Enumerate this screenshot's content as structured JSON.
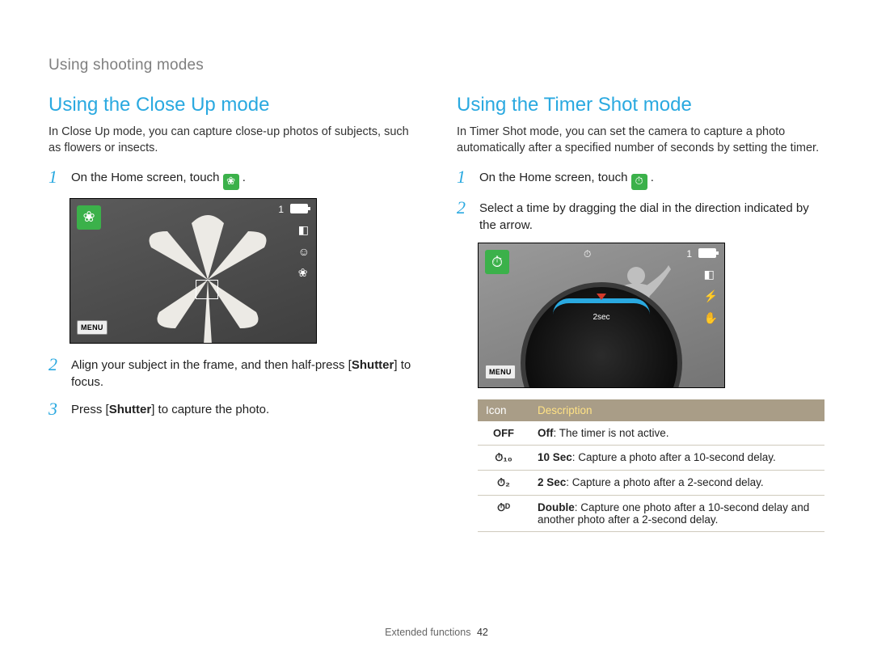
{
  "breadcrumb": "Using shooting modes",
  "footer": {
    "section": "Extended functions",
    "page": "42"
  },
  "left": {
    "heading": "Using the Close Up mode",
    "intro": "In Close Up mode, you can capture close-up photos of subjects, such as flowers or insects.",
    "steps": {
      "s1_pre": "On the Home screen, touch ",
      "s1_post": ".",
      "s2_a": "Align your subject in the frame, and then half-press [",
      "s2_b": "Shutter",
      "s2_c": "] to focus.",
      "s3_a": "Press [",
      "s3_b": "Shutter",
      "s3_c": "] to capture the photo."
    },
    "preview": {
      "counter": "1",
      "menu": "MENU"
    }
  },
  "right": {
    "heading": "Using the Timer Shot mode",
    "intro": "In Timer Shot mode, you can set the camera to capture a photo automatically after a specified number of seconds by setting the timer.",
    "steps": {
      "s1_pre": "On the Home screen, touch ",
      "s1_post": ".",
      "s2": "Select a time by dragging the dial in the direction indicated by the arrow."
    },
    "preview": {
      "counter": "1",
      "menu": "MENU",
      "dial_label": "2sec",
      "timer_top": "⏱"
    },
    "table": {
      "head_icon": "Icon",
      "head_desc": "Description",
      "rows": [
        {
          "icon": "OFF",
          "label": "Off",
          "desc": ": The timer is not active."
        },
        {
          "icon": "⏱₁₀",
          "label": "10 Sec",
          "desc": ": Capture a photo after a 10-second delay."
        },
        {
          "icon": "⏱₂",
          "label": "2 Sec",
          "desc": ": Capture a photo after a 2-second delay."
        },
        {
          "icon": "⏱ᴰ",
          "label": "Double",
          "desc": ": Capture one photo after a 10-second delay and another photo after a 2-second delay."
        }
      ]
    }
  }
}
